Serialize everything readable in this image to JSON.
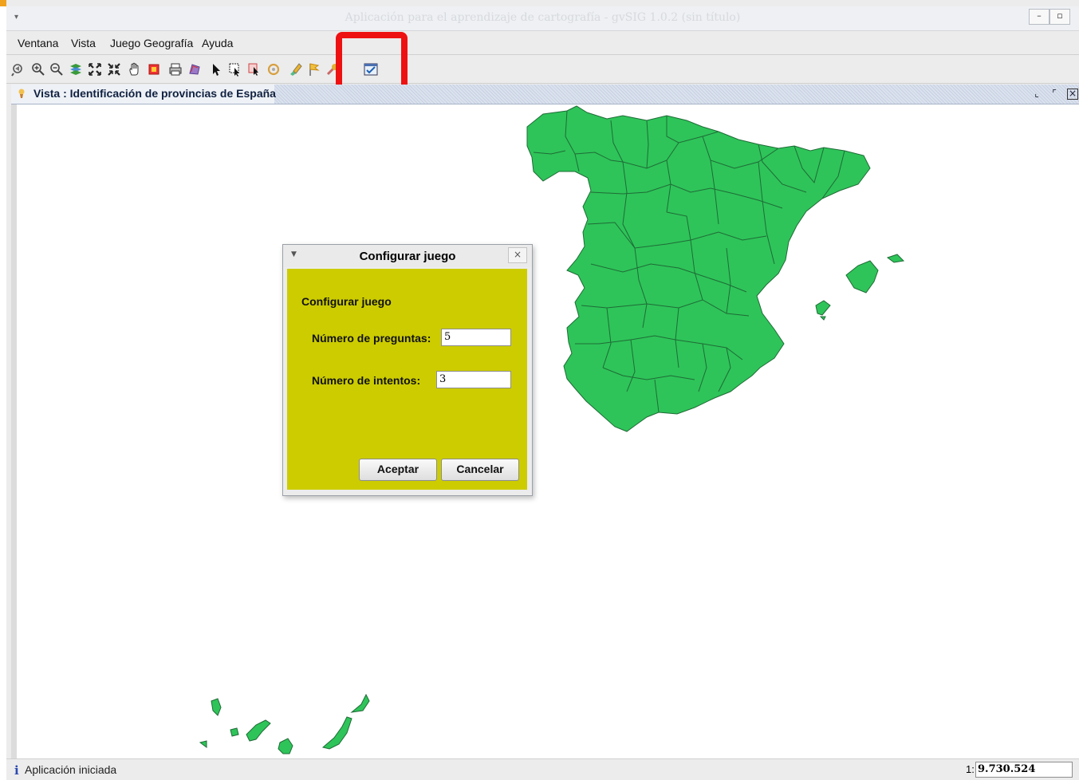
{
  "window": {
    "title": "Aplicación para el aprendizaje de cartografía - gvSIG 1.0.2 (sin título)",
    "minimize_label": "–",
    "maximize_label": "▫"
  },
  "menu": {
    "items": [
      {
        "label": "Ventana"
      },
      {
        "label": "Vista"
      },
      {
        "label": "Juego Geografía"
      },
      {
        "label": "Ayuda"
      }
    ]
  },
  "toolbar": {
    "icons": [
      "zoom-previous-icon",
      "zoom-in-icon",
      "zoom-out-icon",
      "layers-icon",
      "zoom-full-icon",
      "zoom-extent-icon",
      "pan-hand-icon",
      "zoom-layer-icon",
      "print-icon",
      "polygon-select-icon",
      "pointer-icon",
      "select-rectangle-icon",
      "select-point-icon",
      "refresh-icon",
      "edit-icon",
      "flag-icon",
      "tool-icon",
      "configure-game-icon"
    ]
  },
  "view": {
    "title": "Vista : Identificación de provincias de España"
  },
  "dialog": {
    "title": "Configurar juego",
    "close_label": "×",
    "heading": "Configurar juego",
    "questions_label": "Número de preguntas:",
    "questions_value": "5",
    "attempts_label": "Número de intentos:",
    "attempts_value": "3",
    "accept_label": "Aceptar",
    "cancel_label": "Cancelar"
  },
  "status": {
    "message": "Aplicación iniciada",
    "scale_prefix": "1:",
    "scale_value": "9.730.524"
  },
  "colors": {
    "map_fill": "#2ec459",
    "map_stroke": "#1f6b36",
    "dialog_body": "#cccc00",
    "highlight": "#ee1111"
  }
}
